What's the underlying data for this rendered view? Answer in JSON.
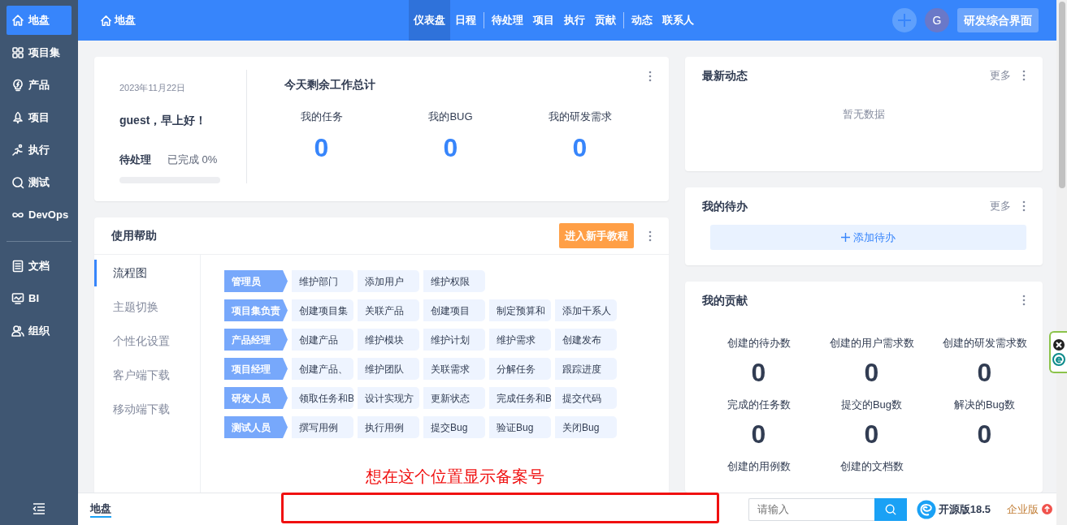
{
  "sidebar": {
    "groups": [
      [
        {
          "label": "地盘",
          "selected": true
        },
        {
          "label": "项目集",
          "selected": false
        },
        {
          "label": "产品",
          "selected": false
        },
        {
          "label": "项目",
          "selected": false
        },
        {
          "label": "执行",
          "selected": false
        },
        {
          "label": "测试",
          "selected": false
        },
        {
          "label": "DevOps",
          "selected": false
        }
      ],
      [
        {
          "label": "文档",
          "selected": false
        },
        {
          "label": "BI",
          "selected": false
        },
        {
          "label": "组织",
          "selected": false
        }
      ]
    ]
  },
  "topbar": {
    "breadcrumb": "地盘",
    "nav_groups": [
      [
        {
          "label": "仪表盘",
          "selected": true
        },
        {
          "label": "日程",
          "selected": false
        }
      ],
      [
        {
          "label": "待处理",
          "selected": false
        },
        {
          "label": "项目",
          "selected": false
        },
        {
          "label": "执行",
          "selected": false
        },
        {
          "label": "贡献",
          "selected": false
        }
      ],
      [
        {
          "label": "动态",
          "selected": false
        },
        {
          "label": "联系人",
          "selected": false
        }
      ]
    ],
    "avatar": "G",
    "switch_button": "研发综合界面"
  },
  "welcome": {
    "date": "2023年11月22日",
    "greeting": "guest，早上好！",
    "pending": "待处理",
    "done": "已完成 0%",
    "level": 0,
    "summary_title": "今天剩余工作总计",
    "stats": [
      {
        "label": "我的任务",
        "value": "0"
      },
      {
        "label": "我的BUG",
        "value": "0"
      },
      {
        "label": "我的研发需求",
        "value": "0"
      }
    ]
  },
  "help": {
    "title": "使用帮助",
    "tutorial_button": "进入新手教程",
    "menu": [
      {
        "label": "流程图",
        "selected": true
      },
      {
        "label": "主题切换",
        "selected": false
      },
      {
        "label": "个性化设置",
        "selected": false
      },
      {
        "label": "客户端下载",
        "selected": false
      },
      {
        "label": "移动端下载",
        "selected": false
      }
    ],
    "flow": [
      {
        "role": "管理员",
        "steps": [
          "维护部门",
          "添加用户",
          "维护权限"
        ]
      },
      {
        "role": "项目集负责",
        "steps": [
          "创建项目集",
          "关联产品",
          "创建项目",
          "制定预算和",
          "添加干系人"
        ]
      },
      {
        "role": "产品经理",
        "steps": [
          "创建产品",
          "维护模块",
          "维护计划",
          "维护需求",
          "创建发布"
        ]
      },
      {
        "role": "项目经理",
        "steps": [
          "创建产品、",
          "维护团队",
          "关联需求",
          "分解任务",
          "跟踪进度"
        ]
      },
      {
        "role": "研发人员",
        "steps": [
          "领取任务和B",
          "设计实现方",
          "更新状态",
          "完成任务和B",
          "提交代码"
        ]
      },
      {
        "role": "测试人员",
        "steps": [
          "撰写用例",
          "执行用例",
          "提交Bug",
          "验证Bug",
          "关闭Bug"
        ]
      }
    ]
  },
  "news": {
    "title": "最新动态",
    "more": "更多",
    "empty": "暂无数据"
  },
  "todo": {
    "title": "我的待办",
    "more": "更多",
    "add": "添加待办"
  },
  "contribution": {
    "title": "我的贡献",
    "stats": [
      {
        "label": "创建的待办数",
        "value": "0"
      },
      {
        "label": "创建的用户需求数",
        "value": "0"
      },
      {
        "label": "创建的研发需求数",
        "value": "0"
      },
      {
        "label": "完成的任务数",
        "value": "0"
      },
      {
        "label": "提交的Bug数",
        "value": "0"
      },
      {
        "label": "解决的Bug数",
        "value": "0"
      },
      {
        "label": "创建的用例数"
      },
      {
        "label": "创建的文档数"
      }
    ]
  },
  "footer": {
    "tab": "地盘",
    "search_placeholder": "请输入",
    "version": "开源版18.5",
    "enterprise": "企业版"
  },
  "annotation": {
    "text": "想在这个位置显示备案号"
  }
}
